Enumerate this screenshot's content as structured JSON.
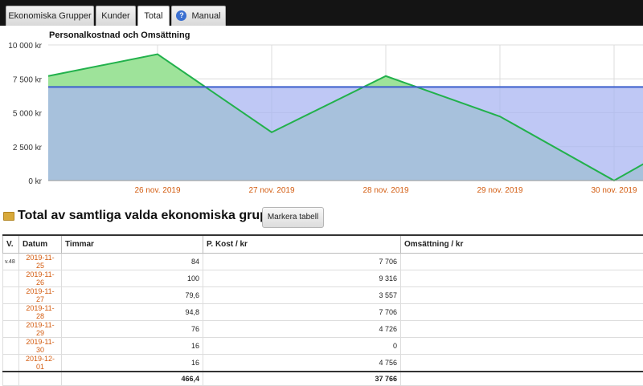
{
  "tabs": [
    {
      "label": "Ekonomiska Grupper"
    },
    {
      "label": "Kunder"
    },
    {
      "label": "Total"
    },
    {
      "label": "Manual"
    }
  ],
  "chart_title": "Personalkostnad och Omsättning",
  "chart_data": {
    "type": "area",
    "title": "Personalkostnad och Omsättning",
    "y_ticks": [
      "0 kr",
      "2 500 kr",
      "5 000 kr",
      "7 500 kr",
      "10 000 kr"
    ],
    "ylim": [
      0,
      10000
    ],
    "x_labels": [
      "26 nov. 2019",
      "27 nov. 2019",
      "28 nov. 2019",
      "29 nov. 2019",
      "30 nov. 2019"
    ],
    "series": [
      {
        "color": "#22b14c",
        "fill": "#9ee39a",
        "values": [
          7706,
          9316,
          3557,
          7706,
          4726,
          0,
          4756
        ]
      },
      {
        "color": "#3c5fcc",
        "fill": "#a9b6f2",
        "values": [
          6900,
          6900,
          6900,
          6900,
          6900,
          6900,
          6900
        ]
      }
    ],
    "grid": true
  },
  "section": {
    "title": "Total av samtliga valda ekonomiska grupper",
    "button_label": "Markera tabell"
  },
  "table": {
    "headers": [
      "V.",
      "Datum",
      "Timmar",
      "P. Kost / kr",
      "Omsättning / kr"
    ],
    "rows": [
      {
        "v": "v.48",
        "date": "2019-11-25",
        "hours": "84",
        "cost": "7 706",
        "revenue": ""
      },
      {
        "v": "",
        "date": "2019-11-26",
        "hours": "100",
        "cost": "9 316",
        "revenue": ""
      },
      {
        "v": "",
        "date": "2019-11-27",
        "hours": "79,6",
        "cost": "3 557",
        "revenue": ""
      },
      {
        "v": "",
        "date": "2019-11-28",
        "hours": "94,8",
        "cost": "7 706",
        "revenue": ""
      },
      {
        "v": "",
        "date": "2019-11-29",
        "hours": "76",
        "cost": "4 726",
        "revenue": ""
      },
      {
        "v": "",
        "date": "2019-11-30",
        "hours": "16",
        "cost": "0",
        "revenue": ""
      },
      {
        "v": "",
        "date": "2019-12-01",
        "hours": "16",
        "cost": "4 756",
        "revenue": ""
      }
    ],
    "totals": {
      "hours": "466,4",
      "cost": "37 766",
      "revenue": ""
    }
  }
}
